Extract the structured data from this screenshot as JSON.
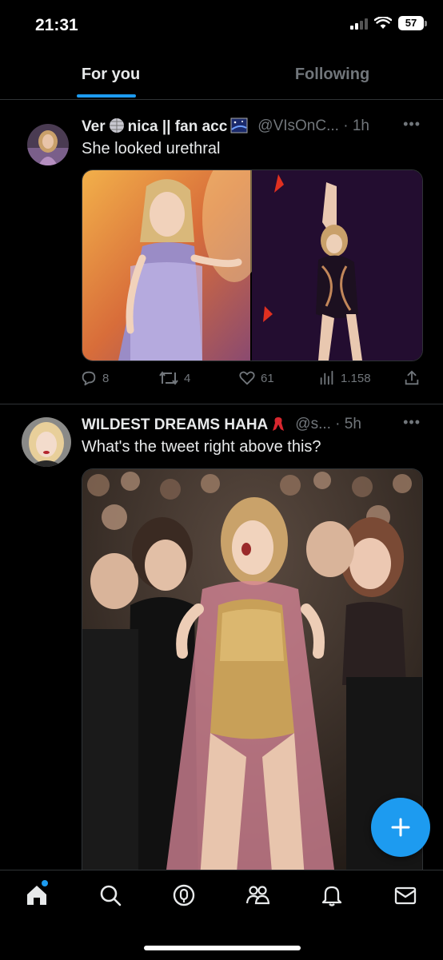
{
  "status_bar": {
    "time": "21:31",
    "battery": "57",
    "icons": [
      "signal-icon",
      "wifi-icon",
      "battery-icon"
    ]
  },
  "tabs": [
    {
      "label": "For you",
      "active": true
    },
    {
      "label": "Following",
      "active": false
    }
  ],
  "tweets": [
    {
      "display_name_part1": "Ver",
      "display_name_part2": "nica || fan acc",
      "name_emojis": [
        "disco-ball-emoji",
        "starry-night-emoji"
      ],
      "handle": "@VIsOnC...",
      "time_sep": " · ",
      "time": "1h",
      "text": "She looked urethral",
      "media": [
        "concert-photo-sequin-dress",
        "concert-photo-dark-stage"
      ],
      "stats": {
        "replies": "8",
        "retweets": "4",
        "likes": "61",
        "views": "1.158"
      }
    },
    {
      "display_name": "WILDEST DREAMS HAHA",
      "name_emojis": [
        "ribbon-emoji"
      ],
      "handle": "@s...",
      "time_sep": " · ",
      "time": "5h",
      "text": "What's the tweet right above this?",
      "media": [
        "crowd-photo-gold-dress"
      ]
    }
  ],
  "nav": {
    "items": [
      "home-icon",
      "search-icon",
      "spaces-icon",
      "communities-icon",
      "notifications-icon",
      "messages-icon"
    ],
    "home_has_badge": true
  },
  "colors": {
    "accent": "#1d9bf0",
    "background": "#000000",
    "text": "#e7e9ea",
    "muted": "#71767b",
    "border": "#2f3336"
  }
}
